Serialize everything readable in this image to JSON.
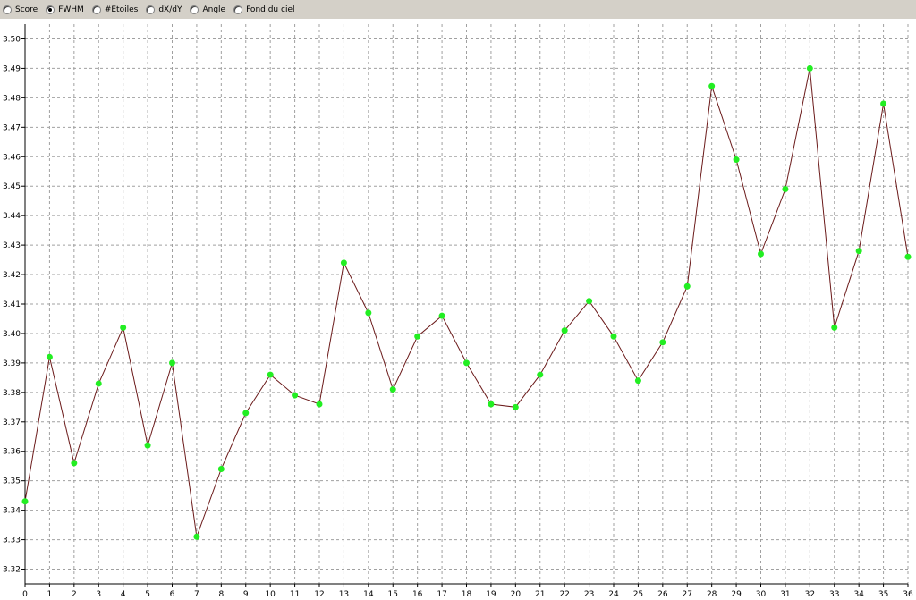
{
  "toolbar": {
    "options": [
      {
        "label": "Score",
        "selected": false
      },
      {
        "label": "FWHM",
        "selected": true
      },
      {
        "label": "#Etoiles",
        "selected": false
      },
      {
        "label": "dX/dY",
        "selected": false
      },
      {
        "label": "Angle",
        "selected": false
      },
      {
        "label": "Fond du ciel",
        "selected": false
      }
    ]
  },
  "chart_data": {
    "type": "line",
    "title": "",
    "xlabel": "",
    "ylabel": "",
    "xlim": [
      0,
      36
    ],
    "ylim": [
      3.315,
      3.505
    ],
    "grid": true,
    "x_ticks": [
      "0",
      "1",
      "2",
      "3",
      "4",
      "5",
      "6",
      "7",
      "8",
      "9",
      "10",
      "11",
      "12",
      "13",
      "14",
      "15",
      "16",
      "17",
      "18",
      "19",
      "20",
      "21",
      "22",
      "23",
      "24",
      "25",
      "26",
      "27",
      "28",
      "29",
      "30",
      "31",
      "32",
      "33",
      "34",
      "35",
      "36"
    ],
    "y_ticks": [
      "3.32",
      "3.33",
      "3.34",
      "3.35",
      "3.36",
      "3.37",
      "3.38",
      "3.39",
      "3.40",
      "3.41",
      "3.42",
      "3.43",
      "3.44",
      "3.45",
      "3.46",
      "3.47",
      "3.48",
      "3.49",
      "3.50"
    ],
    "series": [
      {
        "x": [
          0,
          1,
          2,
          3,
          4,
          5,
          6,
          7,
          8,
          9,
          10,
          11,
          12,
          13,
          14,
          15,
          16,
          17,
          18,
          19,
          20,
          21,
          22,
          23,
          24,
          25,
          26,
          27,
          28,
          29,
          30,
          31,
          32,
          33,
          34,
          35,
          36
        ],
        "values": [
          3.343,
          3.392,
          3.356,
          3.383,
          3.402,
          3.362,
          3.39,
          3.331,
          3.354,
          3.373,
          3.386,
          3.379,
          3.376,
          3.424,
          3.407,
          3.381,
          3.399,
          3.406,
          3.39,
          3.376,
          3.375,
          3.386,
          3.401,
          3.411,
          3.399,
          3.384,
          3.397,
          3.416,
          3.484,
          3.459,
          3.427,
          3.449,
          3.49,
          3.402,
          3.428,
          3.478,
          3.426
        ],
        "line_color": "#6b1a1a",
        "marker_color": "#22ee22"
      }
    ]
  }
}
